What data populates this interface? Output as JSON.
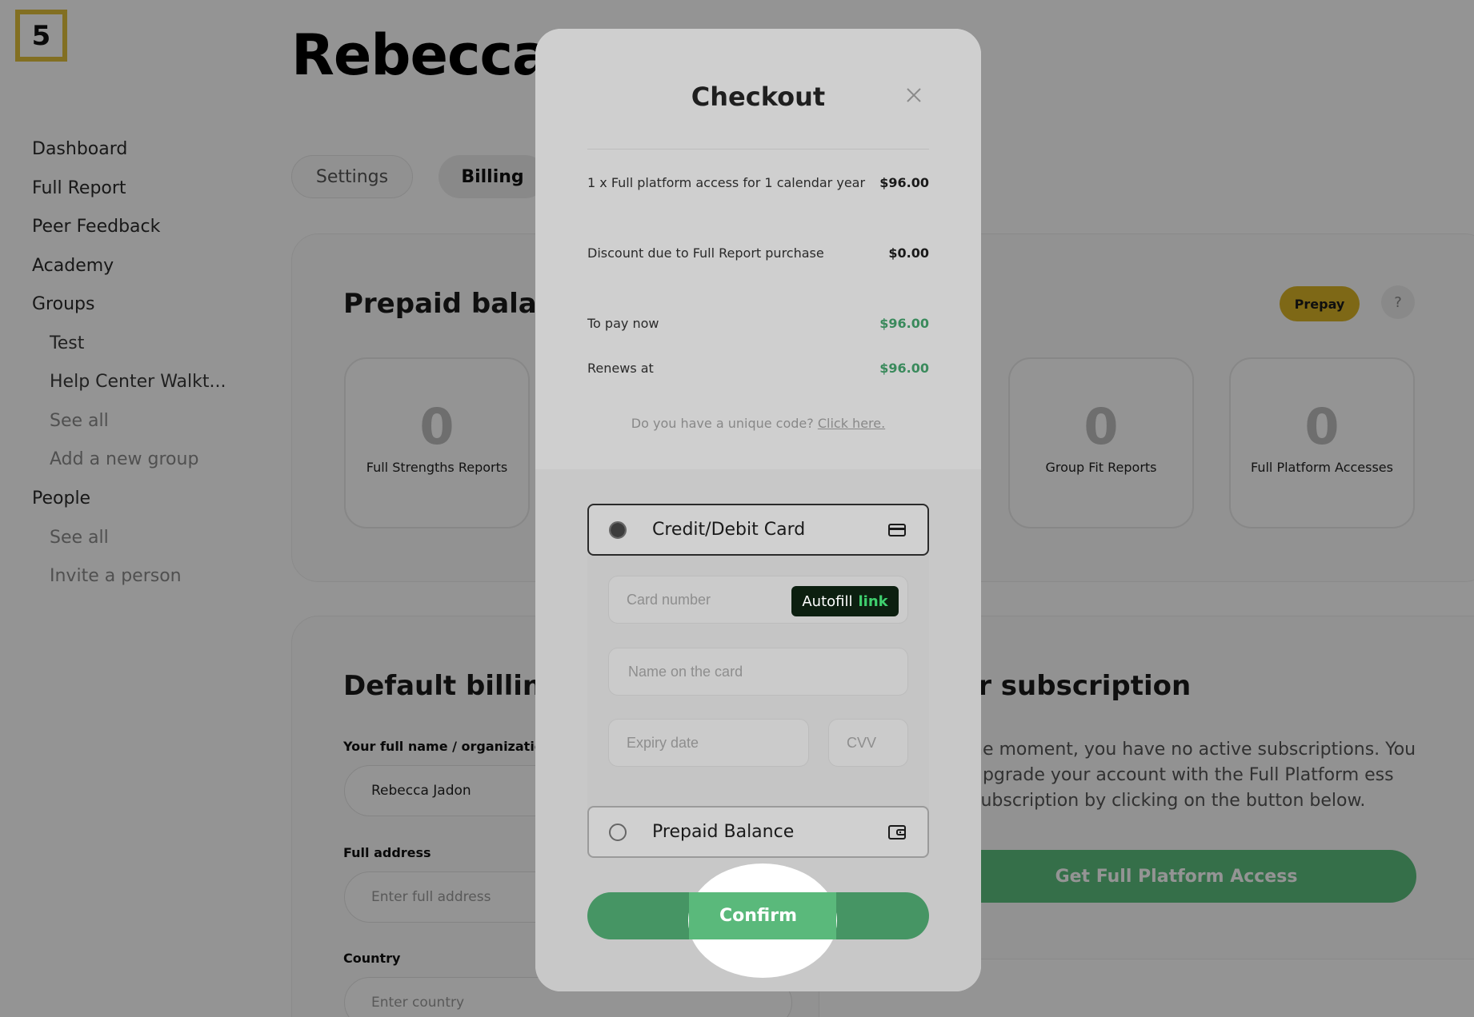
{
  "logo": {
    "text": "5",
    "color": "#e0bf3c"
  },
  "sidebar": {
    "items": [
      {
        "label": "Dashboard"
      },
      {
        "label": "Full Report"
      },
      {
        "label": "Peer Feedback"
      },
      {
        "label": "Academy"
      },
      {
        "label": "Groups"
      },
      {
        "label": "Test"
      },
      {
        "label": "Help Center Walkt..."
      },
      {
        "label": "See all"
      },
      {
        "label": "Add a new group"
      },
      {
        "label": "People"
      },
      {
        "label": "See all"
      },
      {
        "label": "Invite a person"
      }
    ]
  },
  "header": {
    "title": "Rebecca J"
  },
  "tabs": [
    {
      "label": "Settings"
    },
    {
      "label": "Billing"
    }
  ],
  "prepaid": {
    "title": "Prepaid balanc",
    "prepay_label": "Prepay",
    "help_label": "?",
    "stats": [
      {
        "value": "0",
        "label": "Full Strengths Reports"
      },
      {
        "value": "0",
        "label": "Group Fit Reports"
      },
      {
        "value": "0",
        "label": "Full Platform Accesses"
      }
    ]
  },
  "billing": {
    "title": "Default billing",
    "name_label": "Your full name / organization",
    "name_value": "Rebecca Jadon",
    "address_label": "Full address",
    "address_placeholder": "Enter full address",
    "country_label": "Country",
    "country_placeholder": "Enter country"
  },
  "subscription": {
    "title": "ur subscription",
    "text": "he moment, you have no active subscriptions. You upgrade your account with the Full Platform ess subscription by clicking on the button below.",
    "button_label": "Get Full Platform Access",
    "button_color": "#5cc07f"
  },
  "modal": {
    "title": "Checkout",
    "lines": [
      {
        "label": "1 x Full platform access for 1 calendar year",
        "amount": "$96.00"
      },
      {
        "label": "Discount due to Full Report purchase",
        "amount": "$0.00"
      },
      {
        "label": "To pay now",
        "amount": "$96.00"
      },
      {
        "label": "Renews at",
        "amount": "$96.00"
      }
    ],
    "code_prompt": "Do you have a unique code?",
    "code_link": "Click here.",
    "payment_options": [
      {
        "label": "Credit/Debit Card",
        "icon": "credit-card-icon",
        "selected": true
      },
      {
        "label": "Prepaid Balance",
        "icon": "wallet-icon",
        "selected": false
      }
    ],
    "card_fields": {
      "number_placeholder": "Card number",
      "name_placeholder": "Name on the card",
      "expiry_placeholder": "Expiry date",
      "cvv_placeholder": "CVV"
    },
    "autofill": {
      "label": "Autofill",
      "link": "link"
    },
    "confirm_label": "Confirm",
    "accent_green": "#3a8a5c"
  }
}
